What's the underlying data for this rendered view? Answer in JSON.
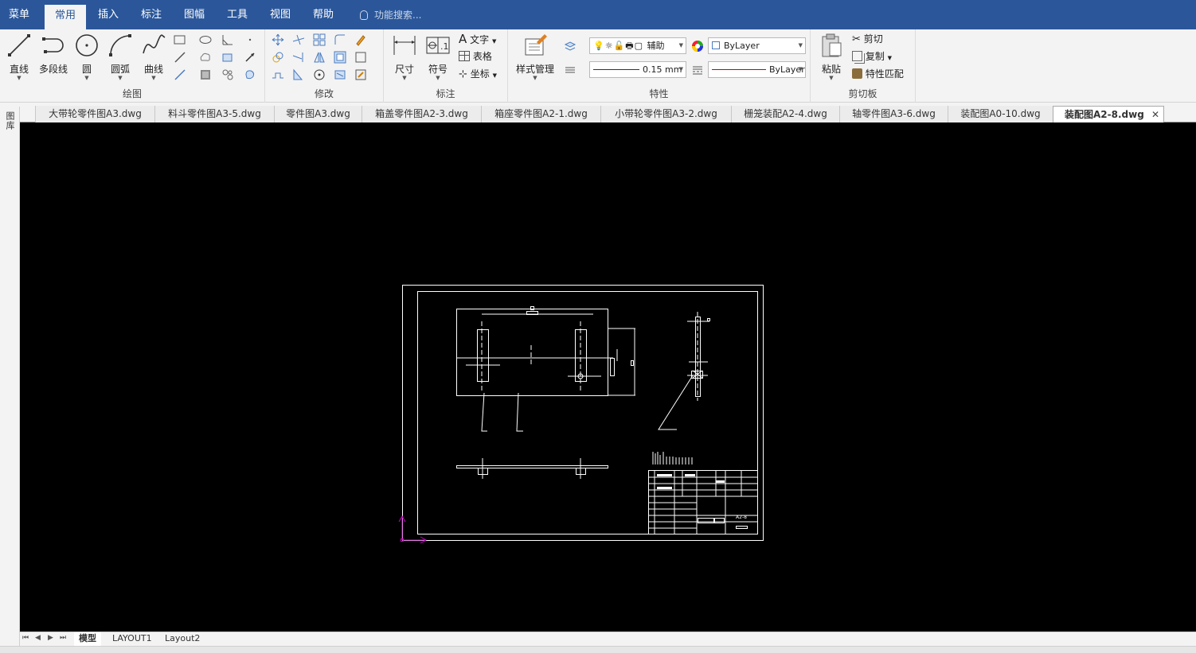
{
  "menubar": {
    "items": [
      {
        "label": "菜单"
      },
      {
        "label": "常用"
      },
      {
        "label": "插入"
      },
      {
        "label": "标注"
      },
      {
        "label": "图幅"
      },
      {
        "label": "工具"
      },
      {
        "label": "视图"
      },
      {
        "label": "帮助"
      }
    ],
    "active_index": 1,
    "search_placeholder": "功能搜索..."
  },
  "ribbon": {
    "draw": {
      "group_label": "绘图",
      "line_label": "直线",
      "polyline_label": "多段线",
      "circle_label": "圆",
      "arc_label": "圆弧",
      "curve_label": "曲线"
    },
    "modify": {
      "group_label": "修改"
    },
    "annotate": {
      "group_label": "标注",
      "dimension_label": "尺寸",
      "symbol_label": "符号",
      "text_label": "文字",
      "table_label": "表格",
      "coordinate_label": "坐标"
    },
    "properties": {
      "group_label": "特性",
      "style_manager_label": "样式管理",
      "layer_value": "辅助",
      "lineweight_value": "0.15 mm",
      "color_value": "ByLayer",
      "linetype_value": "ByLayer"
    },
    "clipboard": {
      "group_label": "剪切板",
      "paste_label": "粘贴",
      "cut_label": "剪切",
      "copy_label": "复制",
      "match_props_label": "特性匹配"
    }
  },
  "document_tabs": [
    {
      "label": "大带轮零件图A3.dwg"
    },
    {
      "label": "料斗零件图A3-5.dwg"
    },
    {
      "label": "零件图A3.dwg"
    },
    {
      "label": "箱盖零件图A2-3.dwg"
    },
    {
      "label": "箱座零件图A2-1.dwg"
    },
    {
      "label": "小带轮零件图A3-2.dwg"
    },
    {
      "label": "栅笼装配A2-4.dwg"
    },
    {
      "label": "轴零件图A3-6.dwg"
    },
    {
      "label": "装配图A0-10.dwg"
    },
    {
      "label": "装配图A2-8.dwg"
    }
  ],
  "active_document_index": 9,
  "sidebar": {
    "label": "图库"
  },
  "drawing": {
    "title_block_text": "A2-8"
  },
  "layout_tabs": [
    {
      "label": "模型"
    },
    {
      "label": "LAYOUT1"
    },
    {
      "label": "Layout2"
    }
  ],
  "active_layout_index": 0,
  "colors": {
    "ribbon_blue": "#2b579a",
    "canvas_bg": "#000000",
    "drawing_line": "#ffffff",
    "ucs_icon": "#c800c8",
    "color_swatch_red": "#cc0000"
  }
}
